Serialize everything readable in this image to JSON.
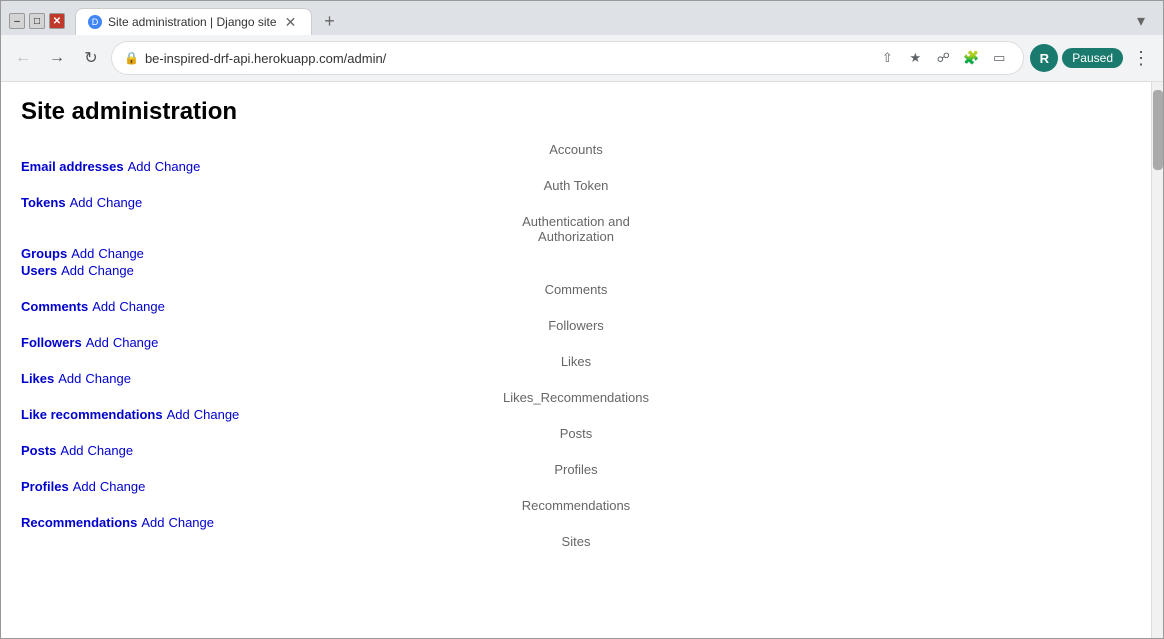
{
  "browser": {
    "tab_title": "Site administration | Django site",
    "url": "be-inspired-drf-api.herokuapp.com/admin/",
    "profile_initial": "R",
    "paused_label": "Paused",
    "new_tab_tooltip": "New tab"
  },
  "page": {
    "title": "Site administration",
    "sections": [
      {
        "name": "Accounts",
        "items": [
          {
            "label": "Email addresses",
            "bold": true,
            "actions": [
              "Add",
              "Change"
            ]
          }
        ]
      },
      {
        "name": "Auth Token",
        "items": [
          {
            "label": "Tokens",
            "bold": true,
            "actions": [
              "Add",
              "Change"
            ]
          }
        ]
      },
      {
        "name": "Authentication and Authorization",
        "items": [
          {
            "label": "Groups",
            "bold": true,
            "actions": [
              "Add",
              "Change"
            ]
          },
          {
            "label": "Users",
            "bold": true,
            "actions": [
              "Add",
              "Change"
            ]
          }
        ]
      },
      {
        "name": "Comments",
        "items": [
          {
            "label": "Comments",
            "bold": true,
            "actions": [
              "Add",
              "Change"
            ]
          }
        ]
      },
      {
        "name": "Followers",
        "items": [
          {
            "label": "Followers",
            "bold": true,
            "actions": [
              "Add",
              "Change"
            ]
          }
        ]
      },
      {
        "name": "Likes",
        "items": [
          {
            "label": "Likes",
            "bold": true,
            "actions": [
              "Add",
              "Change"
            ]
          }
        ]
      },
      {
        "name": "Likes_Recommendations",
        "items": [
          {
            "label": "Like recommendations",
            "bold": true,
            "actions": [
              "Add",
              "Change"
            ]
          }
        ]
      },
      {
        "name": "Posts",
        "items": [
          {
            "label": "Posts",
            "bold": true,
            "actions": [
              "Add",
              "Change"
            ]
          }
        ]
      },
      {
        "name": "Profiles",
        "items": [
          {
            "label": "Profiles",
            "bold": true,
            "actions": [
              "Add",
              "Change"
            ]
          }
        ]
      },
      {
        "name": "Recommendations",
        "items": [
          {
            "label": "Recommendations",
            "bold": true,
            "actions": [
              "Add",
              "Change"
            ]
          }
        ]
      },
      {
        "name": "Sites",
        "items": []
      }
    ]
  }
}
